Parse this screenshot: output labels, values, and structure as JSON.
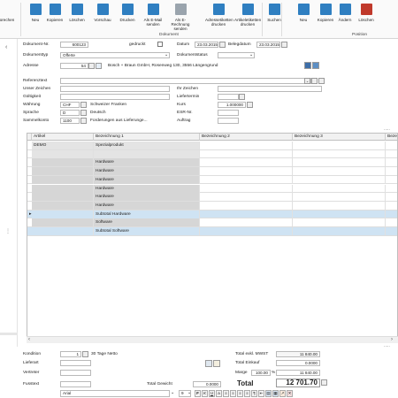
{
  "ribbon": {
    "partial_left": "orechen",
    "buttons": [
      {
        "label": "Neu",
        "color": "#2f7fc1"
      },
      {
        "label": "Kopieren",
        "color": "#2f7fc1"
      },
      {
        "label": "Löschen",
        "color": "#2f7fc1"
      },
      {
        "label": "Vorschau",
        "color": "#2f7fc1"
      },
      {
        "label": "Drucken",
        "color": "#2f7fc1"
      },
      {
        "label": "Als E-Mail senden",
        "color": "#2f7fc1"
      },
      {
        "label": "Als E-Rechnung senden",
        "color": "#9aa4ad"
      },
      {
        "label": "Adressetiketten drucken",
        "color": "#2f7fc1"
      },
      {
        "label": "Artikeletiketten drucken",
        "color": "#2f7fc1"
      },
      {
        "label": "Suchen",
        "color": "#2f7fc1"
      },
      {
        "label": "Neu",
        "color": "#2f7fc1"
      },
      {
        "label": "Kopieren",
        "color": "#2f7fc1"
      },
      {
        "label": "Ändern",
        "color": "#2f7fc1"
      },
      {
        "label": "Löschen",
        "color": "#c0392b"
      }
    ],
    "group_dokument": "Dokument",
    "group_position": "Position"
  },
  "form": {
    "dokument_nr_label": "Dokument-Nr.",
    "dokument_nr": "600123",
    "gedruckt_label": "gedruckt",
    "datum_label": "Datum",
    "datum": "23.03.2015",
    "belegdatum_label": "Belegdatum",
    "belegdatum": "23.03.2015",
    "dokumenttyp_label": "Dokumenttyp",
    "dokumenttyp": "Offerte",
    "dokumentstatus_label": "Dokumentstatus",
    "adresse_label": "Adresse",
    "adresse_nr": "54",
    "adresse_text": "Bosch + Braun GmbH, Rosenweg 130, 3556 Längengrund",
    "referenztext_label": "Referenztext",
    "unser_zeichen_label": "Unser Zeichen",
    "ihr_zeichen_label": "Ihr Zeichen",
    "gueltigkeit_label": "Gültigkeit",
    "liefertermin_label": "Liefertermin",
    "waehrung_label": "Währung",
    "waehrung_code": "CHF",
    "waehrung_name": "Schweizer Franken",
    "kurs_label": "Kurs",
    "kurs": "1.000000",
    "sprache_label": "Sprache",
    "sprache_code": "D",
    "sprache_name": "Deutsch",
    "esr_label": "ESR-Nr.",
    "sammelkonto_label": "Sammelkonto",
    "sammelkonto_nr": "1100",
    "sammelkonto_name": "Forderungen aus Lieferunge...",
    "auftrag_label": "Auftrag"
  },
  "grid": {
    "headers": [
      "Artikel",
      "Bezeichnung 1",
      "Bezeichnung 2",
      "Bezeichnung 3",
      "Bezei"
    ],
    "rows": [
      {
        "artikel": "DEMO",
        "bez1": "Spezialprodukt",
        "type": "g1",
        "marker": ""
      },
      {
        "artikel": "",
        "bez1": "",
        "type": "g1",
        "marker": ""
      },
      {
        "artikel": "",
        "bez1": "Hardware",
        "type": "g2",
        "marker": ""
      },
      {
        "artikel": "",
        "bez1": "Hardware",
        "type": "g2",
        "marker": ""
      },
      {
        "artikel": "",
        "bez1": "Hardware",
        "type": "g2",
        "marker": ""
      },
      {
        "artikel": "",
        "bez1": "Hardware",
        "type": "g2",
        "marker": ""
      },
      {
        "artikel": "",
        "bez1": "Hardware",
        "type": "g2",
        "marker": ""
      },
      {
        "artikel": "",
        "bez1": "Hardware",
        "type": "g2",
        "marker": ""
      },
      {
        "artikel": "",
        "bez1": "Subtotal Hardware",
        "type": "sel",
        "marker": "▸"
      },
      {
        "artikel": "",
        "bez1": "Software",
        "type": "g2",
        "marker": ""
      },
      {
        "artikel": "",
        "bez1": "Subtotal Software",
        "type": "sel",
        "marker": ""
      }
    ]
  },
  "footer": {
    "kondition_label": "Kondition",
    "kondition_nr": "1",
    "kondition_text": "30 Tage Netto",
    "lieferart_label": "Lieferart",
    "vertreter_label": "Vertreter",
    "fusstext_label": "Fusstext",
    "total_gewicht_label": "Total Gewicht",
    "total_gewicht": "0.0000",
    "font_name": "Arial",
    "font_size": "9",
    "total_exkl_label": "Total exkl. MWST",
    "total_exkl": "11 840.00",
    "total_einkauf_label": "Total Einkauf",
    "total_einkauf": "0.0000",
    "marge_label": "Marge",
    "marge_pct": "100.00",
    "marge_pct_sign": "%",
    "marge_value": "11 840.00",
    "total_label": "Total",
    "total": "12 701.70"
  }
}
